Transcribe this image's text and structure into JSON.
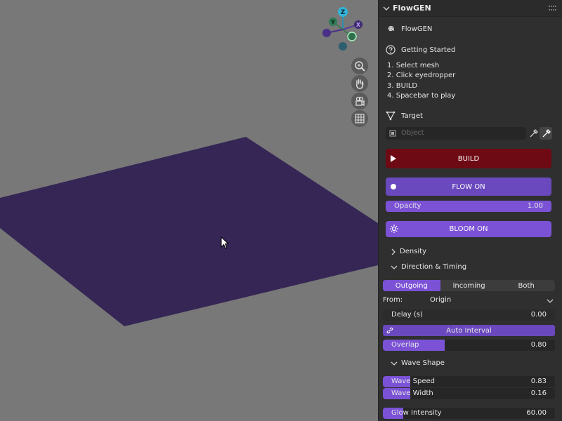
{
  "panel": {
    "title": "FlowGEN",
    "brand_label": "FlowGEN",
    "getting_started_label": "Getting Started",
    "steps": [
      "1. Select mesh",
      "2. Click eyedropper",
      "3. BUILD",
      "4. Spacebar to play"
    ],
    "target_label": "Target",
    "object_placeholder": "Object",
    "build_label": "BUILD",
    "flow_label": "FLOW ON",
    "opacity": {
      "label": "Opacity",
      "value": "1.00"
    },
    "bloom_label": "BLOOM ON",
    "density_label": "Density",
    "direction_label": "Direction & Timing",
    "direction_tabs": [
      "Outgoing",
      "Incoming",
      "Both"
    ],
    "active_direction": "Outgoing",
    "from": {
      "label": "From:",
      "value": "Origin"
    },
    "delay": {
      "label": "Delay (s)",
      "value": "0.00"
    },
    "auto_interval_label": "Auto Interval",
    "overlap": {
      "label": "Overlap",
      "value": "0.80",
      "level": 0.8
    },
    "wave_shape_label": "Wave Shape",
    "wave_speed": {
      "label": "Wave Speed",
      "value": "0.83",
      "level": 0.83
    },
    "wave_width": {
      "label": "Wave Width",
      "value": "0.16",
      "level": 0.16
    },
    "glow_intensity": {
      "label": "Glow Intensity",
      "value": "60.00"
    }
  },
  "gizmo": {
    "z_label": "Z",
    "y_label": "Y",
    "x_label": "X"
  },
  "colors": {
    "accent": "#7b52d6",
    "build_red": "#6e0a14",
    "plane_purple": "#352655",
    "panel_bg": "#2f2f2f",
    "viewport_bg": "#787878"
  },
  "icons": {
    "collapse": "chevron-down-icon",
    "brand": "spiral-icon",
    "help": "question-icon",
    "target": "mesh-triangle-icon",
    "object": "object-square-icon",
    "eyedropper": "eyedropper-icon",
    "play": "play-icon",
    "dot": "dot-icon",
    "bloom": "sun-icon",
    "link": "link-icon"
  }
}
